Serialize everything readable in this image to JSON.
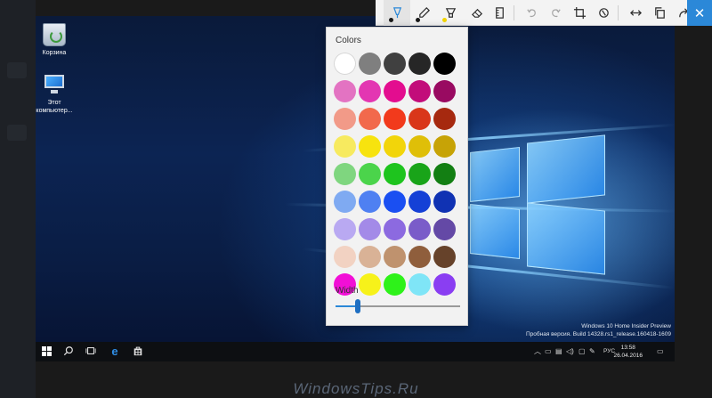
{
  "toolbar": {
    "tools": [
      {
        "name": "ballpoint-pen-icon",
        "dot": "#1a1a1a",
        "active": true
      },
      {
        "name": "pencil-icon",
        "dot": "#1a1a1a",
        "active": false
      },
      {
        "name": "highlighter-icon",
        "dot": "#f2d500",
        "active": false
      },
      {
        "name": "eraser-icon",
        "active": false
      },
      {
        "name": "ruler-icon",
        "active": false
      },
      {
        "name": "undo-icon",
        "active": false,
        "disabled": true
      },
      {
        "name": "redo-icon",
        "active": false,
        "disabled": true
      },
      {
        "name": "crop-icon",
        "active": false
      },
      {
        "name": "touch-writing-icon",
        "active": false
      },
      {
        "name": "full-screen-icon",
        "active": false
      },
      {
        "name": "copy-icon",
        "active": false
      },
      {
        "name": "share-icon",
        "active": false
      }
    ],
    "close_glyph": "✕"
  },
  "color_panel": {
    "title": "Colors",
    "colors": [
      "#ffffff",
      "#7f7f7f",
      "#404040",
      "#262626",
      "#000000",
      "#e373c2",
      "#e336b2",
      "#e30d8f",
      "#c20c7a",
      "#990a61",
      "#f29a88",
      "#f2694c",
      "#f23a1c",
      "#d9361a",
      "#a6290f",
      "#f7ea5f",
      "#f7e30e",
      "#f2d50a",
      "#dfbf08",
      "#c7a306",
      "#7fd67f",
      "#4bd44b",
      "#1ec41e",
      "#19a419",
      "#137f13",
      "#7faaf2",
      "#4f80f2",
      "#1a4ff2",
      "#1540d6",
      "#1032b3",
      "#b9a9f2",
      "#a38ae8",
      "#8c6ae0",
      "#7a5cc9",
      "#6449a6",
      "#f2d2c2",
      "#d9b296",
      "#bf926e",
      "#8f5e3c",
      "#66422a",
      "#f20fd6",
      "#f7f21a",
      "#2ef21a",
      "#7fe5f7",
      "#8a3ef2"
    ],
    "width_label": "Width",
    "width_value": 0.18
  },
  "desktop": {
    "icons": [
      {
        "label": "Корзина"
      },
      {
        "label": "Этот компьютер..."
      }
    ],
    "watermark_line1": "Windows 10 Home Insider Preview",
    "watermark_line2": "Пробная версия. Build 14328.rs1_release.160418-1609"
  },
  "taskbar": {
    "tray_lang": "РУС",
    "clock_time": "13:58",
    "clock_date": "26.04.2016"
  },
  "site_watermark": "WindowsTips.Ru"
}
